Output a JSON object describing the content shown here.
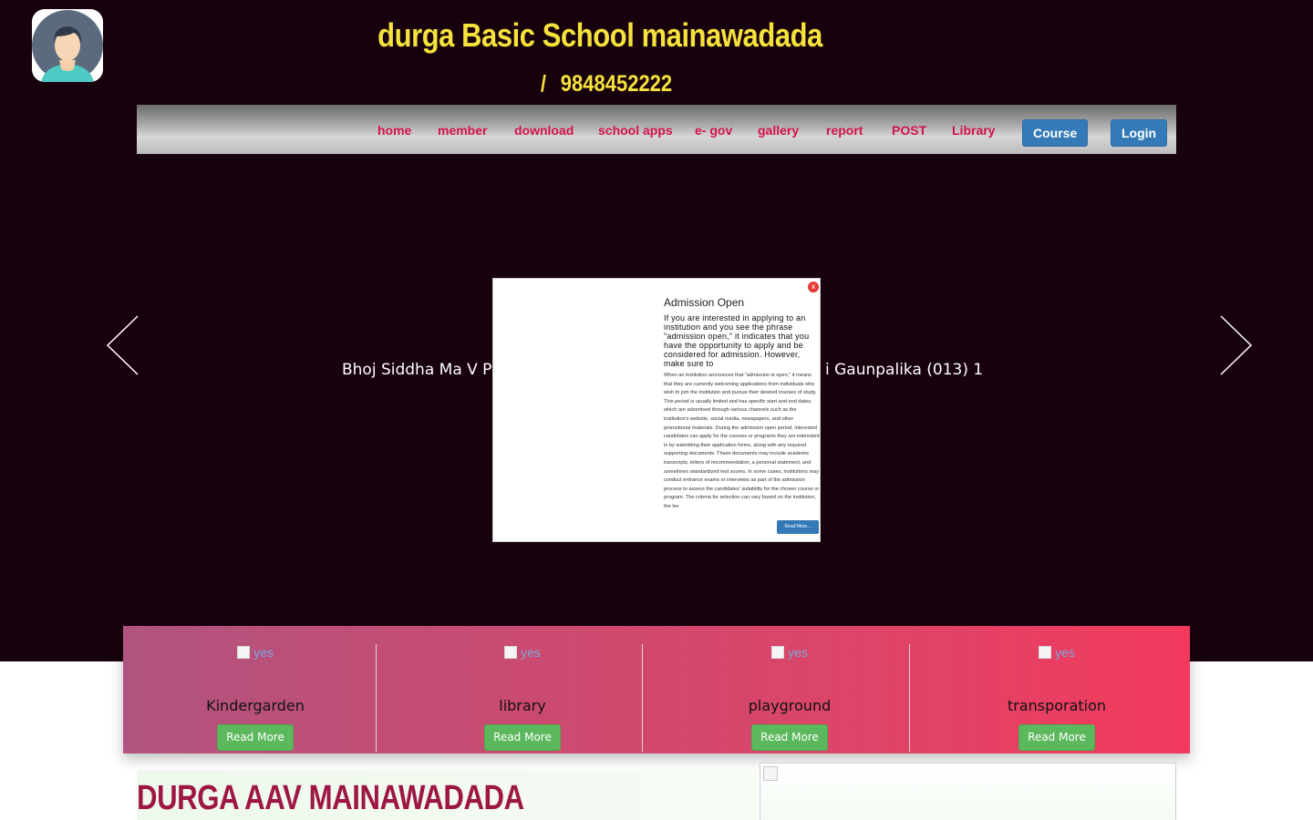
{
  "header": {
    "school_name": "durga Basic School mainawadada",
    "phone_separator": "/",
    "phone": "9848452222"
  },
  "nav": {
    "links": [
      "home",
      "member",
      "download",
      "school apps",
      "e- gov",
      "gallery",
      "report",
      "POST",
      "Library"
    ],
    "course_button": "Course",
    "login_button": "Login",
    "link_color": "#d4124c",
    "button_color": "#337ab7"
  },
  "slider": {
    "caption_left": "Bhoj Siddha Ma V P",
    "caption_right": "i Gaunpalika (013) 1",
    "prev_icon": "arrow-left-icon",
    "next_icon": "arrow-right-icon"
  },
  "modal": {
    "close_label": "x",
    "title": "Admission Open",
    "intro": "If you are interested in applying to an institution and you see the phrase \"admission open,\" it indicates that you have the opportunity to apply and be considered for admission. However, make sure to",
    "body": "When an institution announces that \"admission is open,\" it means that they are currently welcoming applications from individuals who wish to join the institution and pursue their desired courses of study. This period is usually limited and has specific start and end dates, which are advertised through various channels such as the institution's website, social media, newspapers, and other promotional materials. During the admission open period, interested candidates can apply for the courses or programs they are interested in by submitting their application forms, along with any required supporting documents. These documents may include academic transcripts, letters of recommendation, a personal statement, and sometimes standardized test scores. In some cases, institutions may conduct entrance exams or interviews as part of the admission process to assess the candidates' suitability for the chosen course or program. The criteria for selection can vary based on the institution, the lev",
    "read_more": "Read More..."
  },
  "features": {
    "items": [
      {
        "image_alt": "yes",
        "title": "Kindergarden",
        "button": "Read More"
      },
      {
        "image_alt": "yes",
        "title": "library",
        "button": "Read More"
      },
      {
        "image_alt": "yes",
        "title": "playground",
        "button": "Read More"
      },
      {
        "image_alt": "yes",
        "title": "transporation",
        "button": "Read More"
      }
    ]
  },
  "about": {
    "title": "DURGA AAV MAINAWADADA"
  },
  "colors": {
    "hero_bg": "#17010d",
    "title_yellow": "#f6e23c",
    "section_title": "#9e1744",
    "read_more_green": "#5cb85c"
  }
}
